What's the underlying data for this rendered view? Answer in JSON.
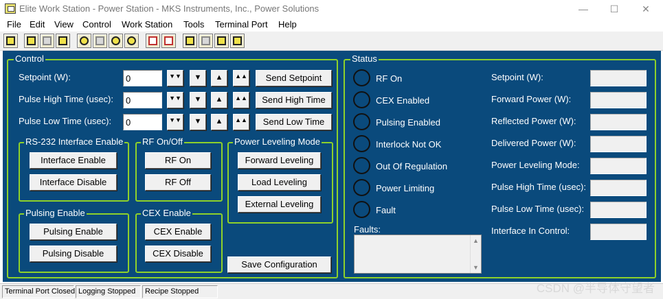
{
  "window": {
    "title": "Elite Work Station - Power Station - MKS Instruments, Inc., Power  Solutions",
    "minimize": "—",
    "maximize": "☐",
    "close": "✕"
  },
  "menu": [
    "File",
    "Edit",
    "View",
    "Control",
    "Work Station",
    "Tools",
    "Terminal Port",
    "Help"
  ],
  "control": {
    "title": "Control",
    "rows": [
      {
        "label": "Setpoint (W):",
        "value": "0",
        "button": "Send Setpoint"
      },
      {
        "label": "Pulse High Time (usec):",
        "value": "0",
        "button": "Send High Time"
      },
      {
        "label": "Pulse Low Time (usec):",
        "value": "0",
        "button": "Send Low Time"
      }
    ],
    "arrows": {
      "dbl_down": "▼▼",
      "down": "▼",
      "up": "▲",
      "dbl_up": "▲▲"
    },
    "rs232": {
      "title": "RS-232 Interface Enable",
      "enable": "Interface Enable",
      "disable": "Interface Disable"
    },
    "rf": {
      "title": "RF On/Off",
      "on": "RF On",
      "off": "RF Off"
    },
    "leveling": {
      "title": "Power Leveling Mode",
      "forward": "Forward Leveling",
      "load": "Load Leveling",
      "external": "External Leveling"
    },
    "pulsing": {
      "title": "Pulsing Enable",
      "enable": "Pulsing Enable",
      "disable": "Pulsing Disable"
    },
    "cex": {
      "title": "CEX Enable",
      "enable": "CEX Enable",
      "disable": "CEX Disable"
    },
    "save": "Save Configuration"
  },
  "status": {
    "title": "Status",
    "indicators": [
      "RF On",
      "CEX Enabled",
      "Pulsing Enabled",
      "Interlock Not OK",
      "Out Of Regulation",
      "Power Limiting",
      "Fault"
    ],
    "faults_label": "Faults:",
    "fields": [
      "Setpoint (W):",
      "Forward Power (W):",
      "Reflected Power (W):",
      "Delivered Power (W):",
      "Power Leveling Mode:",
      "Pulse High Time (usec):",
      "Pulse Low Time (usec):",
      "Interface In Control:"
    ]
  },
  "statusbar": {
    "terminal": "Terminal Port Closed",
    "logging": "Logging Stopped",
    "recipe": "Recipe Stopped"
  },
  "watermark": "CSDN @半导体守望者",
  "colors": {
    "panel": "#0a4a7c",
    "group_border": "#8ed12a"
  }
}
